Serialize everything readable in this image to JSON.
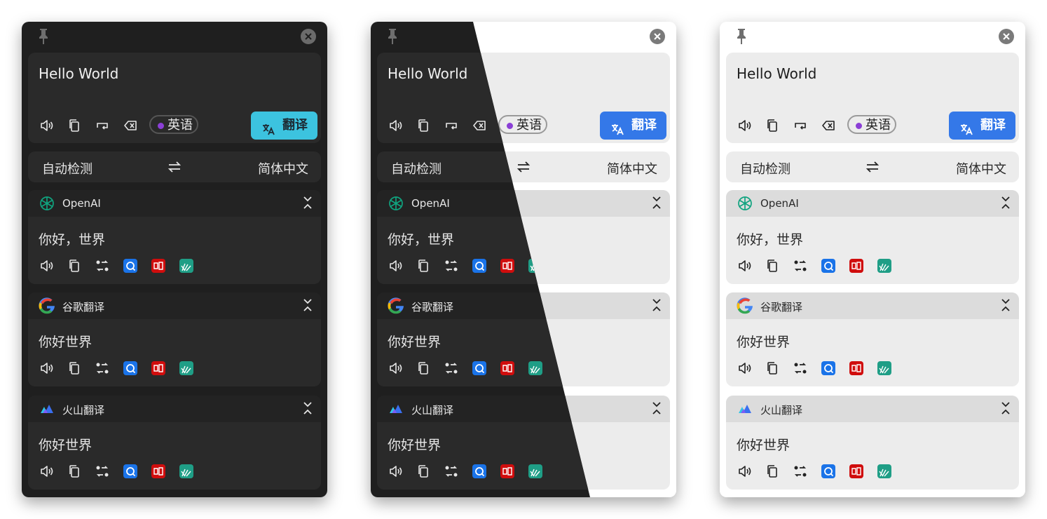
{
  "panels": [
    {
      "id": "dark",
      "theme": "dark"
    },
    {
      "id": "split",
      "theme": "split"
    },
    {
      "id": "light",
      "theme": "light"
    }
  ],
  "input": {
    "text": "Hello World",
    "detected_language": "英语",
    "translate_label": "翻译"
  },
  "language_bar": {
    "source": "自动检测",
    "target": "简体中文"
  },
  "results": [
    {
      "service": "OpenAI",
      "text": "你好，世界",
      "logo": "openai-icon"
    },
    {
      "service": "谷歌翻译",
      "text": "你好世界",
      "logo": "google-icon"
    },
    {
      "service": "火山翻译",
      "text": "你好世界",
      "logo": "volcengine-icon"
    }
  ],
  "colors": {
    "dark_accent": "#3cc3df",
    "light_accent": "#3478e8",
    "language_dot": "#8b3fd6",
    "openai_green": "#10a37f",
    "dict_blue": "#1a73e8",
    "youdao_red": "#d00d0d",
    "lingvo_teal": "#1f9e86"
  }
}
